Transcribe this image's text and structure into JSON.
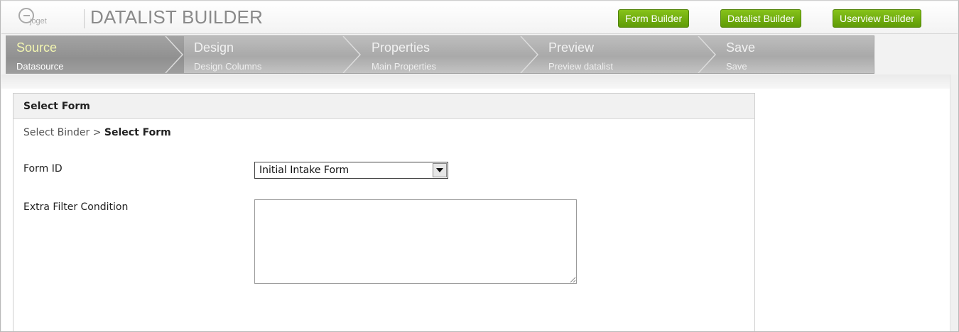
{
  "header": {
    "logo_text": "joget",
    "title": "DATALIST BUILDER",
    "buttons": [
      "Form Builder",
      "Datalist Builder",
      "Userview Builder"
    ]
  },
  "wizard": {
    "steps": [
      {
        "title": "Source",
        "subtitle": "Datasource"
      },
      {
        "title": "Design",
        "subtitle": "Design Columns"
      },
      {
        "title": "Properties",
        "subtitle": "Main Properties"
      },
      {
        "title": "Preview",
        "subtitle": "Preview datalist"
      },
      {
        "title": "Save",
        "subtitle": "Save"
      }
    ],
    "active_index": 0
  },
  "panel": {
    "title": "Select Form",
    "breadcrumb": {
      "parent": "Select Binder",
      "separator": ">",
      "current": "Select Form"
    },
    "fields": {
      "form_id": {
        "label": "Form ID",
        "value": "Initial Intake Form"
      },
      "extra_filter": {
        "label": "Extra Filter Condition",
        "value": ""
      }
    }
  },
  "colors": {
    "accent_green": "#6aa80c",
    "wizard_active_title": "#f2f5b0"
  }
}
